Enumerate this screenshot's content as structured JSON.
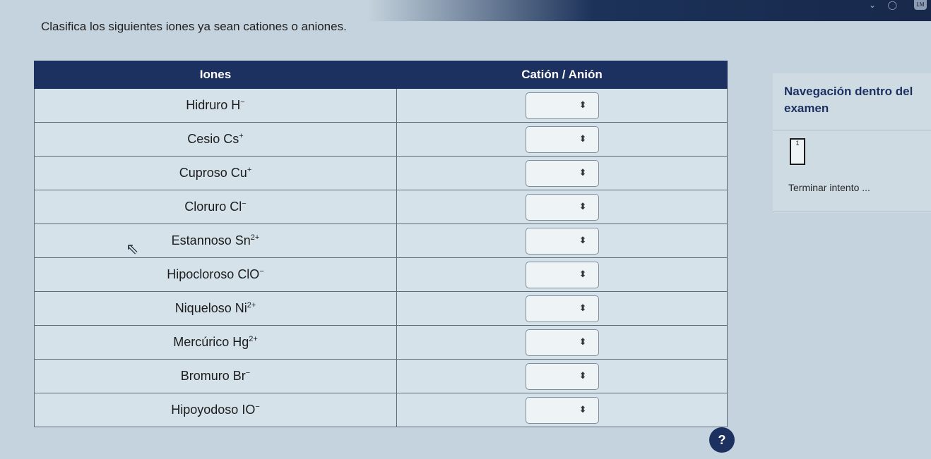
{
  "question": "Clasifica los siguientes iones ya sean cationes o aniones.",
  "table": {
    "headers": [
      "Iones",
      "Catión / Anión"
    ],
    "rows": [
      {
        "name": "Hidruro",
        "symbol": "H",
        "charge": "−"
      },
      {
        "name": "Cesio",
        "symbol": "Cs",
        "charge": "+"
      },
      {
        "name": "Cuproso",
        "symbol": "Cu",
        "charge": "+"
      },
      {
        "name": "Cloruro",
        "symbol": "Cl",
        "charge": "−"
      },
      {
        "name": "Estannoso",
        "symbol": "Sn",
        "charge": "2+"
      },
      {
        "name": "Hipocloroso",
        "symbol": "ClO",
        "charge": "−"
      },
      {
        "name": "Niqueloso",
        "symbol": "Ni",
        "charge": "2+"
      },
      {
        "name": "Mercúrico",
        "symbol": "Hg",
        "charge": "2+"
      },
      {
        "name": "Bromuro",
        "symbol": "Br",
        "charge": "−"
      },
      {
        "name": "Hipoyodoso",
        "symbol": "IO",
        "charge": "−"
      }
    ],
    "selector_value": "",
    "selector_arrow": "⬍"
  },
  "nav": {
    "title": "Navegación dentro del examen",
    "question_number": "1",
    "finish": "Terminar intento ..."
  },
  "help": "?",
  "avatar": "LM",
  "icons": {
    "help": "help-icon",
    "cursor": "mouse-pointer-icon",
    "select_arrow": "select-arrow-icon"
  },
  "colors": {
    "header_bg": "#1d3160",
    "cell_bg": "#d5e2ea",
    "nav_title": "#1d3160"
  }
}
